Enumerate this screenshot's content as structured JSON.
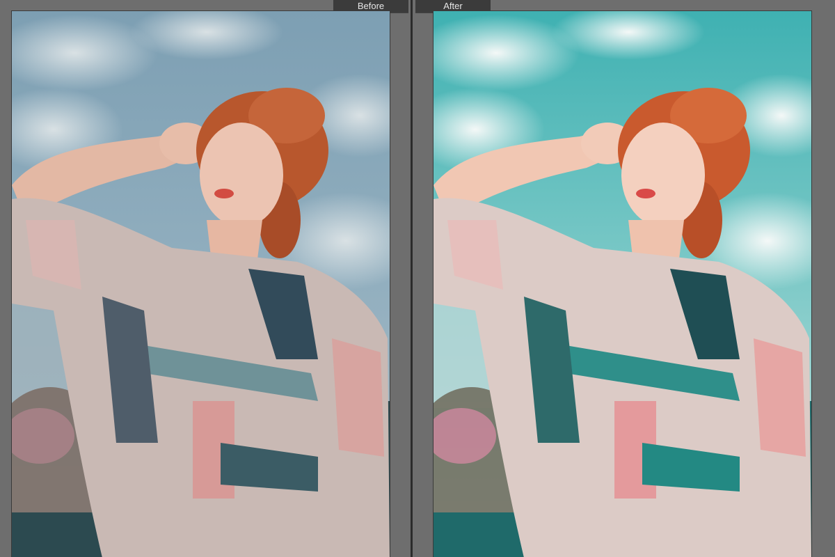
{
  "labels": {
    "before": "Before",
    "after": "After"
  },
  "colors": {
    "background": "#6e6e6e",
    "label_bg": "#3b3b3b",
    "before_sky": "#6d93a8",
    "after_sky": "#3fb3b3"
  }
}
